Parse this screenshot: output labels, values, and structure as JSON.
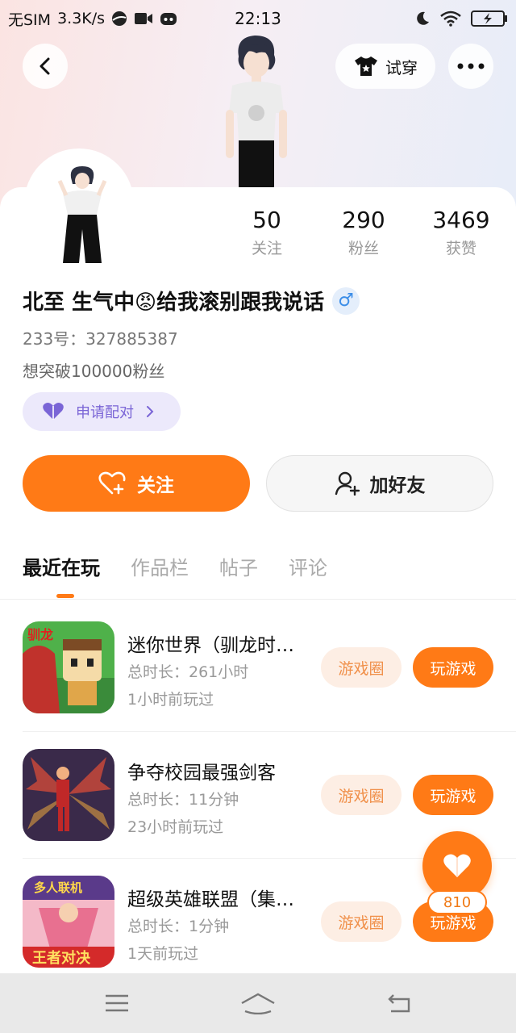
{
  "statusbar": {
    "carrier": "无SIM",
    "speed": "3.3K/s",
    "time": "22:13"
  },
  "header": {
    "try_on_label": "试穿",
    "icons": [
      "back-icon",
      "shirt-icon",
      "more-icon"
    ]
  },
  "profile": {
    "stats": [
      {
        "value": "50",
        "label": "关注"
      },
      {
        "value": "290",
        "label": "粉丝"
      },
      {
        "value": "3469",
        "label": "获赞"
      }
    ],
    "nickname": "北至 生气中😡给我滚别跟我说话",
    "gender_symbol": "♂",
    "uid": "233号：327885387",
    "bio": "想突破100000粉丝",
    "pair_label": "申请配对"
  },
  "actions": {
    "follow_label": "关注",
    "add_friend_label": "加好友"
  },
  "tabs": [
    {
      "label": "最近在玩",
      "active": true
    },
    {
      "label": "作品栏",
      "active": false
    },
    {
      "label": "帖子",
      "active": false
    },
    {
      "label": "评论",
      "active": false
    }
  ],
  "games": [
    {
      "title": "迷你世界（驯龙时…",
      "duration": "总时长：261小时",
      "last_played": "1小时前玩过",
      "circle_label": "游戏圈",
      "play_label": "玩游戏"
    },
    {
      "title": "争夺校园最强剑客",
      "duration": "总时长：11分钟",
      "last_played": "23小时前玩过",
      "circle_label": "游戏圈",
      "play_label": "玩游戏"
    },
    {
      "title": "超级英雄联盟（集…",
      "duration": "总时长：1分钟",
      "last_played": "1天前玩过",
      "circle_label": "游戏圈",
      "play_label": "玩游戏"
    }
  ],
  "like": {
    "count": "810"
  },
  "colors": {
    "accent": "#ff7a16",
    "pair_purple": "#7a65d6",
    "gender_blue": "#3c8ee8"
  }
}
